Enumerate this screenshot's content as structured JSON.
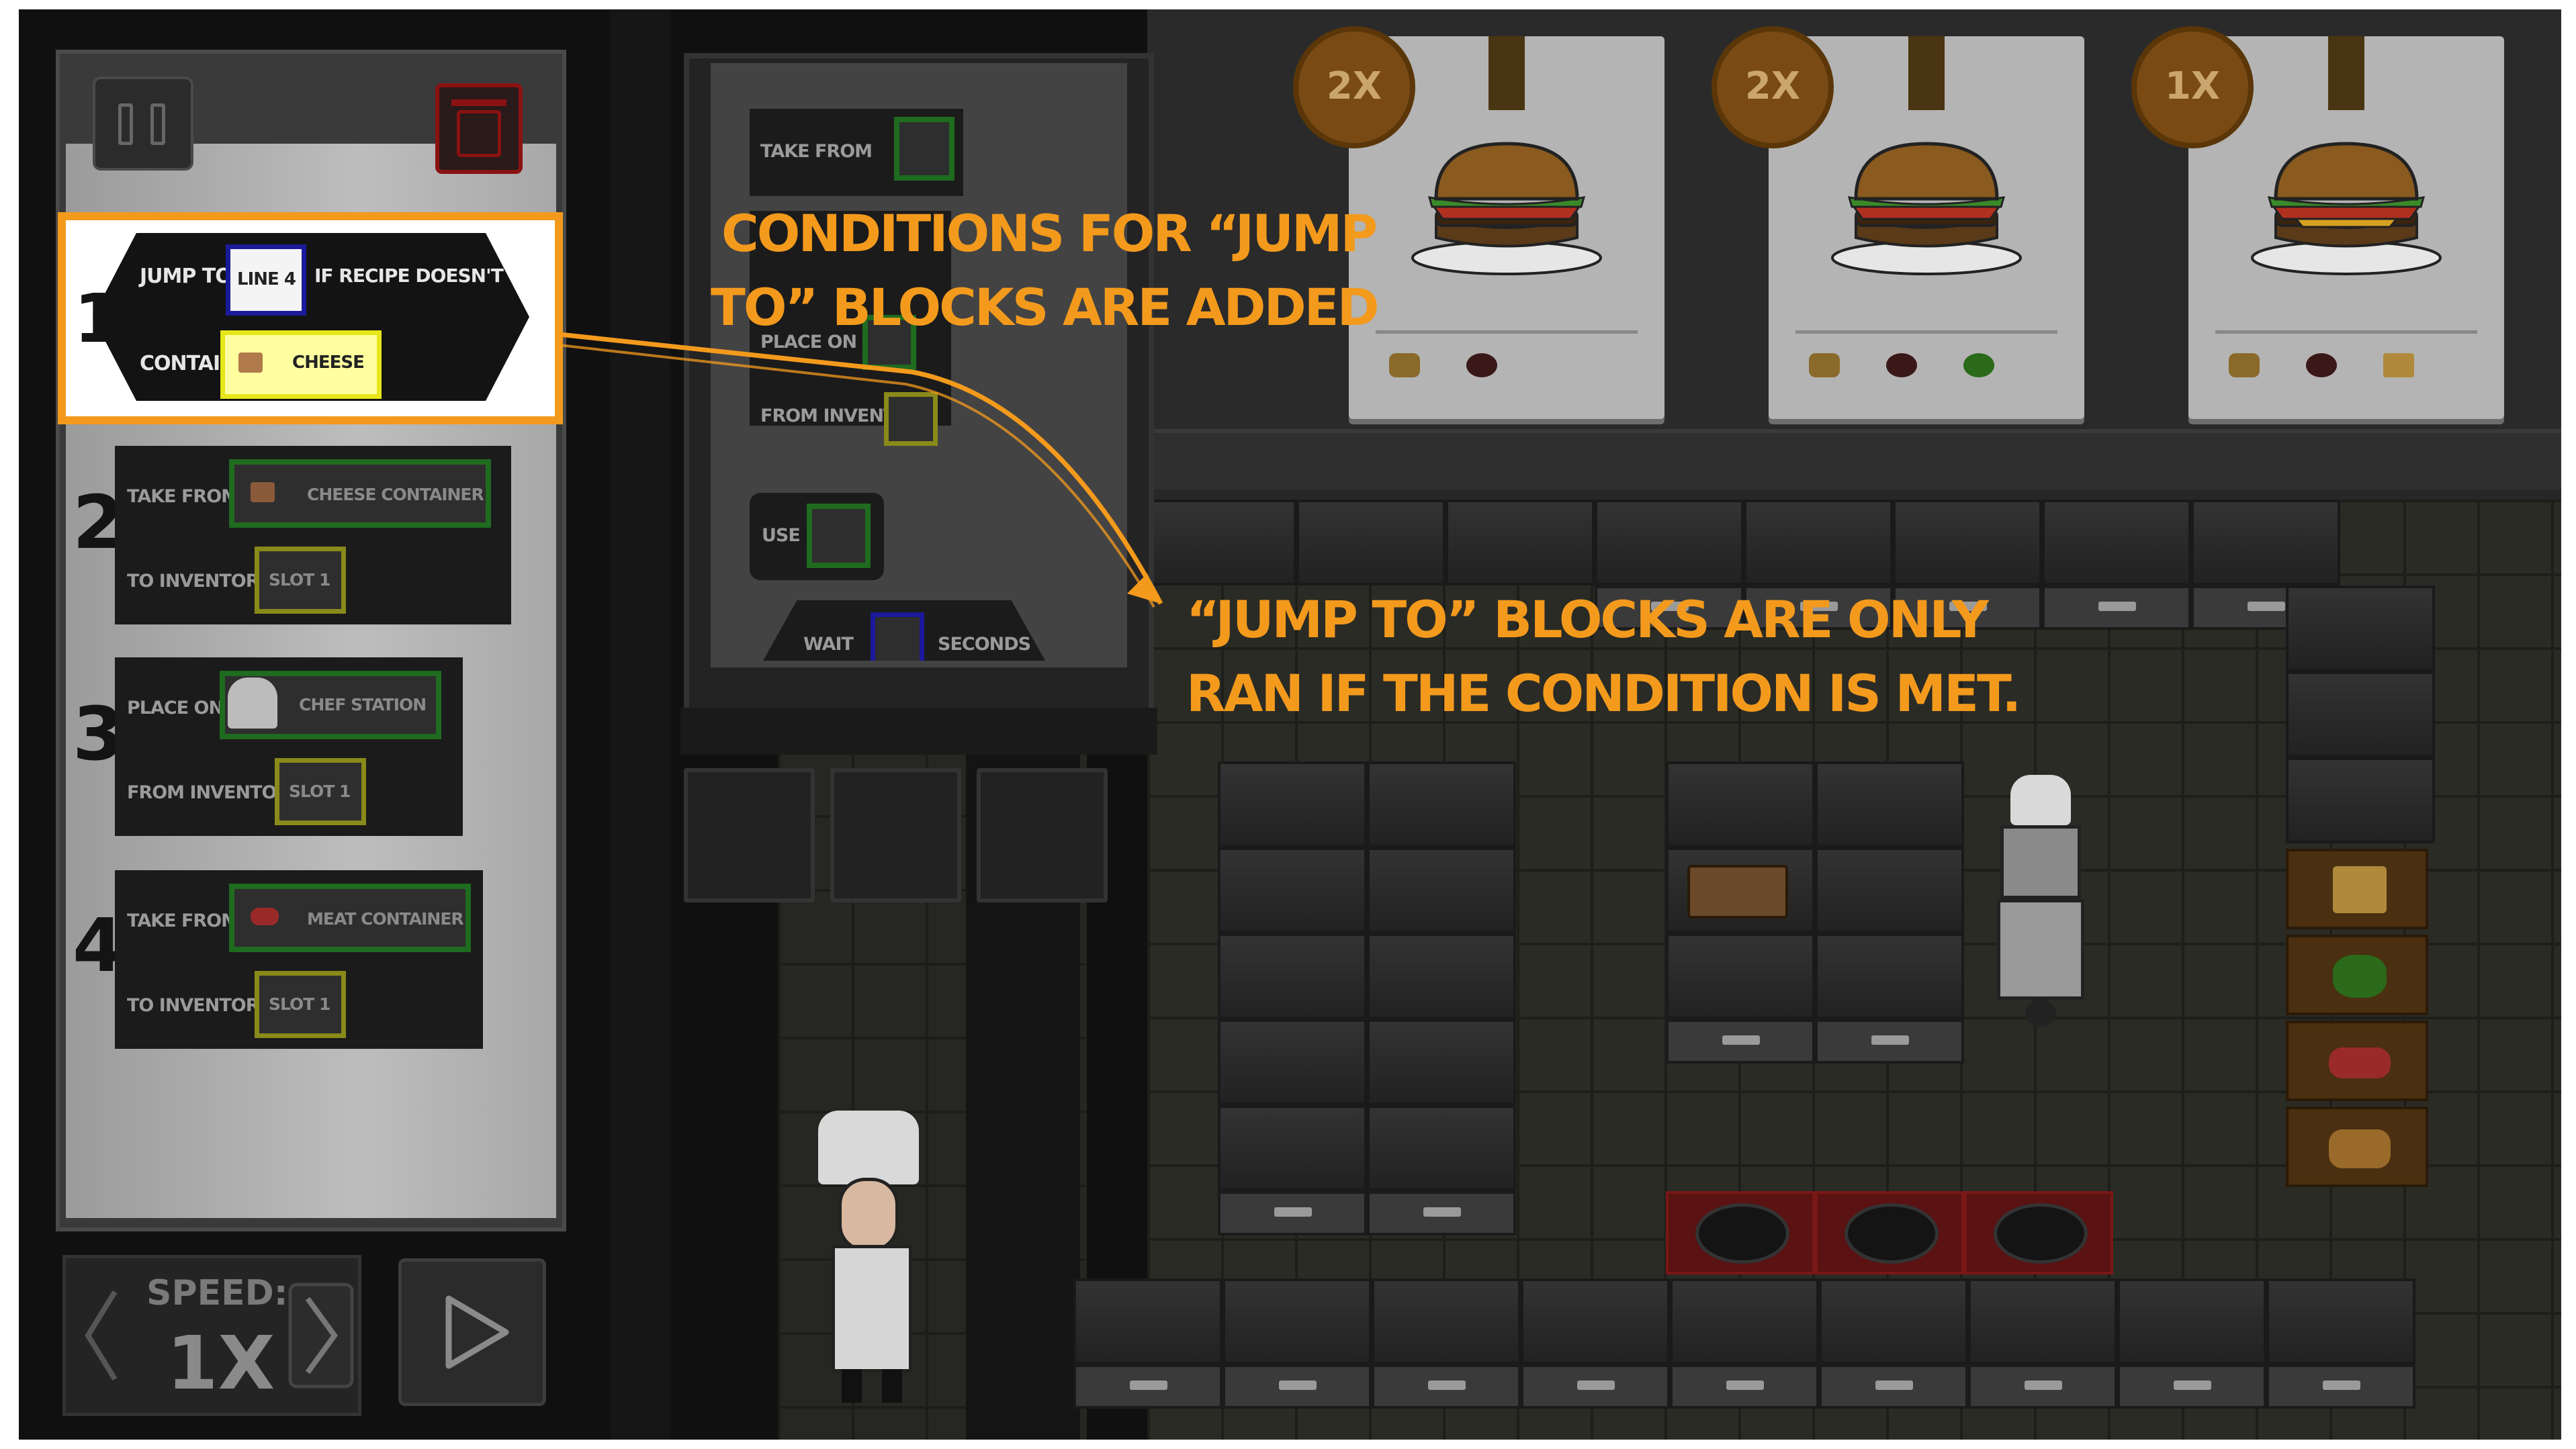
{
  "program": {
    "line1": {
      "number": "1",
      "jump_label": "Jump to",
      "line_target": "Line 4",
      "condition_text": "If recipe doesn't",
      "contain_label": "Contain",
      "ingredient": "Cheese"
    },
    "line2": {
      "number": "2",
      "action_label": "Take from",
      "target": "Cheese Container",
      "sub_label": "To inventory",
      "slot": "Slot 1"
    },
    "line3": {
      "number": "3",
      "action_label": "Place on",
      "target": "Chef Station",
      "sub_label": "From inventory",
      "slot": "Slot 1"
    },
    "line4": {
      "number": "4",
      "action_label": "Take from",
      "target": "Meat Container",
      "sub_label": "To inventory",
      "slot": "Slot 1"
    }
  },
  "palette": {
    "take_from": "Take from",
    "place_on": "Place on",
    "from_inventory": "From inventory",
    "use": "Use",
    "wait": "Wait",
    "seconds": "Seconds"
  },
  "controls": {
    "speed_label": "Speed:",
    "speed_value": "1X"
  },
  "orders": [
    {
      "multiplier": "2X"
    },
    {
      "multiplier": "2X"
    },
    {
      "multiplier": "1X"
    }
  ],
  "annotations": {
    "top_line1": "Conditions for “jump",
    "top_line2": "to” blocks are added",
    "bottom_line1": "“Jump to” blocks are only",
    "bottom_line2": "ran if the condition is met."
  },
  "colors": {
    "annotation": "#f39a1d",
    "slot_green": "#1f6b1f",
    "slot_yellow": "#8a8a1a",
    "slot_blue": "#1a1a9a"
  }
}
